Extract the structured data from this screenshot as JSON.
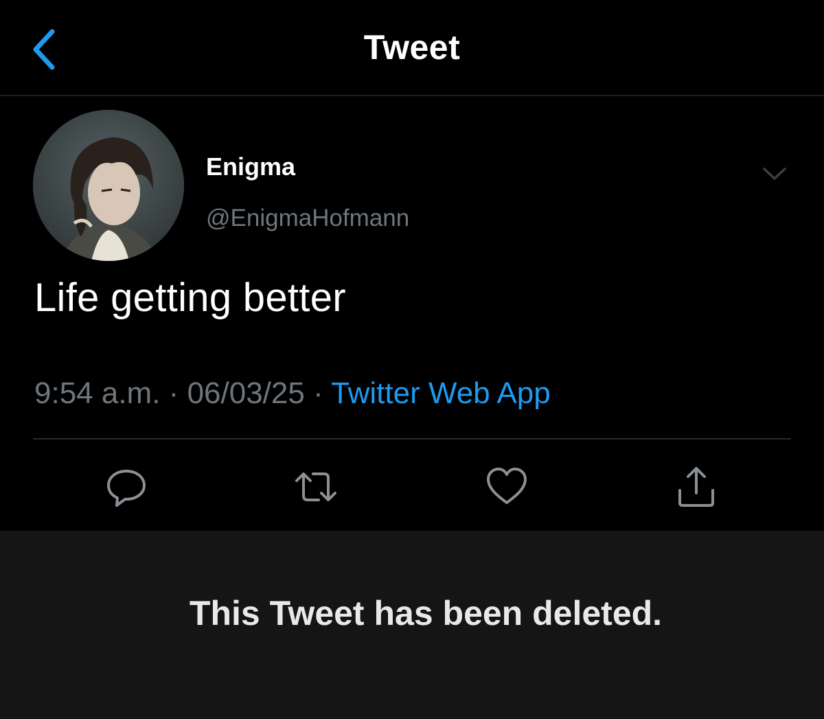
{
  "header": {
    "title": "Tweet",
    "back_icon": "chevron-left-icon"
  },
  "tweet": {
    "author": {
      "display_name": "Enigma",
      "handle": "@EnigmaHofmann",
      "avatar": "anime-character-portrait"
    },
    "text": "Life getting better",
    "time": "9:54 a.m.",
    "separator": "·",
    "date": "06/03/25",
    "source": "Twitter Web App"
  },
  "actions": [
    {
      "icon": "reply-icon"
    },
    {
      "icon": "retweet-icon"
    },
    {
      "icon": "like-icon"
    },
    {
      "icon": "share-icon"
    }
  ],
  "notice": {
    "text": "This Tweet has been deleted."
  },
  "colors": {
    "background": "#000000",
    "accent": "#1d9bf0",
    "secondary_text": "#6e767d",
    "deleted_panel": "#151515"
  }
}
